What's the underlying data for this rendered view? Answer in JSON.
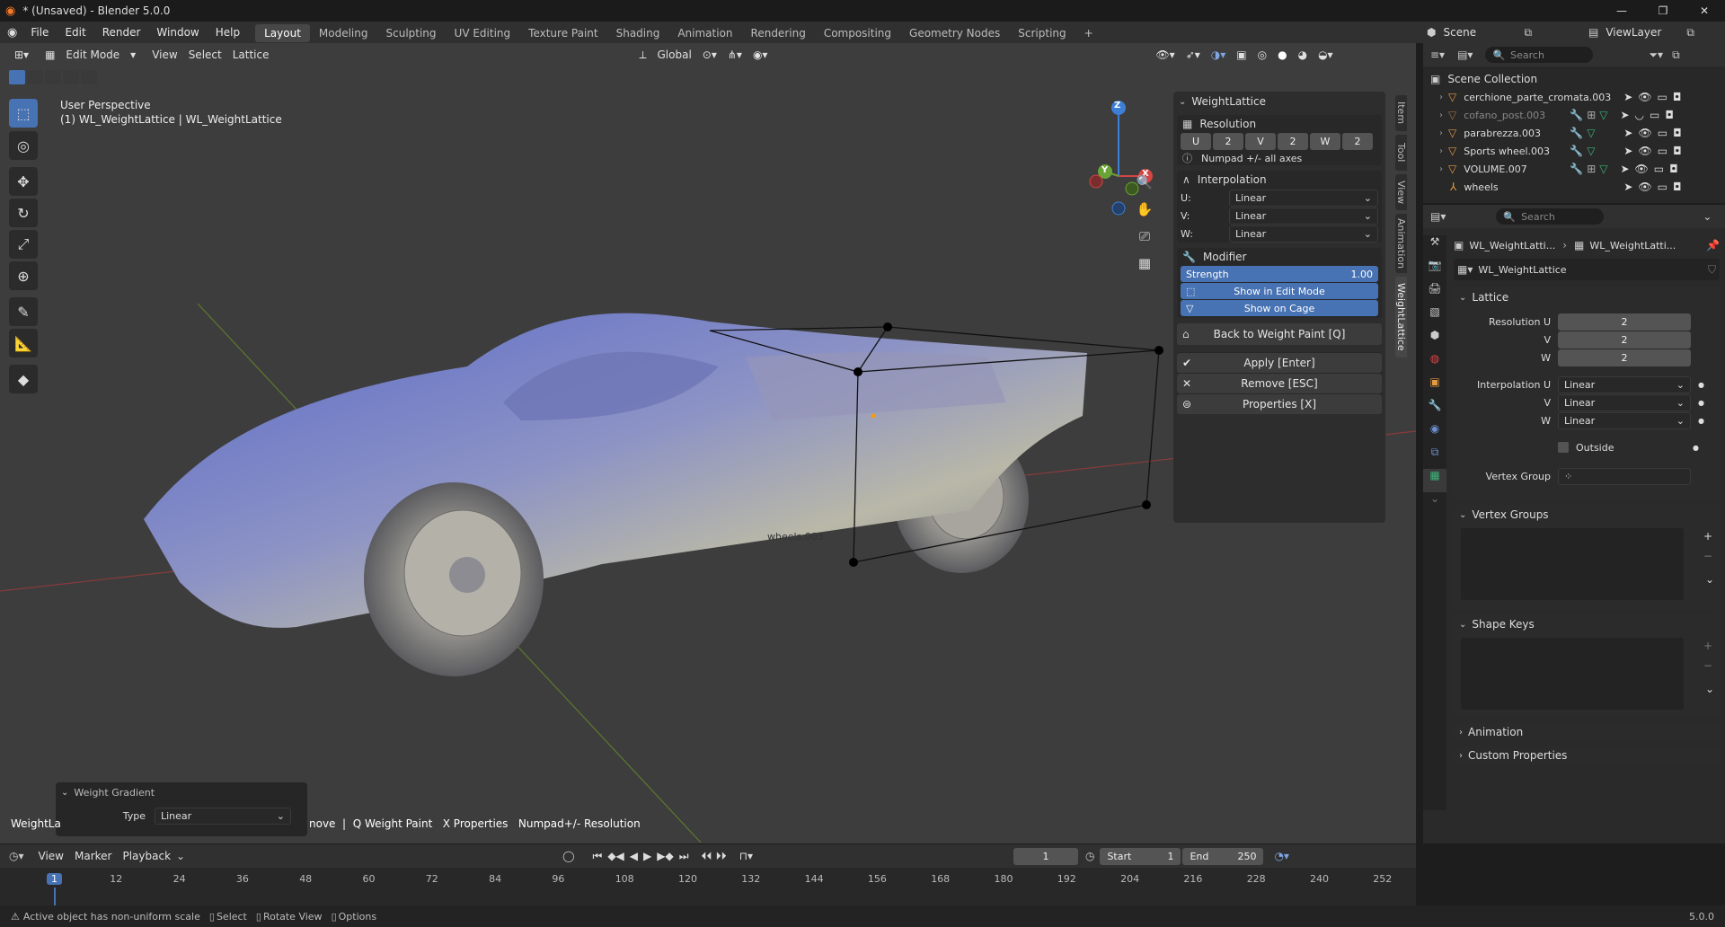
{
  "window": {
    "title": "* (Unsaved) - Blender 5.0.0"
  },
  "menu": {
    "items": [
      "File",
      "Edit",
      "Render",
      "Window",
      "Help"
    ]
  },
  "workspaces": [
    "Layout",
    "Modeling",
    "Sculpting",
    "UV Editing",
    "Texture Paint",
    "Shading",
    "Animation",
    "Rendering",
    "Compositing",
    "Geometry Nodes",
    "Scripting"
  ],
  "workspace_add": "+",
  "topright": {
    "scene": "Scene",
    "viewlayer": "ViewLayer"
  },
  "viewport": {
    "mode": "Edit Mode",
    "menus": [
      "View",
      "Select",
      "Lattice"
    ],
    "orientation": "Global",
    "overlay_title": "User Perspective",
    "overlay_sub": "(1) WL_WeightLattice | WL_WeightLattice",
    "object_label": "wheels.003",
    "hint_left": "WeightLa",
    "hint_text": "nove  |  Q Weight Paint   X Properties   Numpad+/- Resolution",
    "gizmo": {
      "x": "X",
      "y": "Y",
      "z": "Z"
    }
  },
  "npanel": {
    "header": "WeightLattice",
    "resolution": {
      "title": "Resolution",
      "u_label": "U",
      "u": "2",
      "v_label": "V",
      "v": "2",
      "w_label": "W",
      "w": "2",
      "hint": "Numpad +/- all axes"
    },
    "interpolation": {
      "title": "Interpolation",
      "u_label": "U:",
      "u": "Linear",
      "v_label": "V:",
      "v": "Linear",
      "w_label": "W:",
      "w": "Linear"
    },
    "modifier": {
      "title": "Modifier",
      "strength_label": "Strength",
      "strength": "1.00",
      "show_edit": "Show in Edit Mode",
      "show_cage": "Show on Cage"
    },
    "back": "Back to Weight Paint  [Q]",
    "apply": "Apply  [Enter]",
    "remove": "Remove  [ESC]",
    "properties": "Properties  [X]",
    "tabs": [
      "Item",
      "Tool",
      "View",
      "Animation",
      "WeightLattice"
    ]
  },
  "last_op": {
    "title": "Weight Gradient",
    "type_label": "Type",
    "type": "Linear"
  },
  "outliner": {
    "search_placeholder": "Search",
    "collection": "Scene Collection",
    "items": [
      {
        "name": "cerchione_parte_cromata.003"
      },
      {
        "name": "cofano_post.003"
      },
      {
        "name": "parabrezza.003"
      },
      {
        "name": "Sports wheel.003"
      },
      {
        "name": "VOLUME.007"
      },
      {
        "name": "wheels"
      }
    ]
  },
  "properties": {
    "search_placeholder": "Search",
    "breadcrumb_obj": "WL_WeightLatti...",
    "breadcrumb_data": "WL_WeightLatti...",
    "datablock": "WL_WeightLattice",
    "lattice": {
      "title": "Lattice",
      "res_u_label": "Resolution U",
      "res_u": "2",
      "res_v_label": "V",
      "res_v": "2",
      "res_w_label": "W",
      "res_w": "2",
      "interp_u_label": "Interpolation U",
      "interp_u": "Linear",
      "interp_v_label": "V",
      "interp_v": "Linear",
      "interp_w_label": "W",
      "interp_w": "Linear",
      "outside": "Outside",
      "vgroup_label": "Vertex Group"
    },
    "vertex_groups": "Vertex Groups",
    "shape_keys": "Shape Keys",
    "animation": "Animation",
    "custom_props": "Custom Properties"
  },
  "timeline": {
    "menus": [
      "View",
      "Marker",
      "Playback"
    ],
    "current_frame": "1",
    "start_label": "Start",
    "start": "1",
    "end_label": "End",
    "end": "250",
    "ticks": [
      "1",
      "12",
      "24",
      "36",
      "48",
      "60",
      "72",
      "84",
      "96",
      "108",
      "120",
      "132",
      "144",
      "156",
      "168",
      "180",
      "192",
      "204",
      "216",
      "228",
      "240",
      "252"
    ]
  },
  "statusbar": {
    "warning": "Active object has non-uniform scale",
    "select": "Select",
    "rotate": "Rotate View",
    "options": "Options",
    "version": "5.0.0"
  }
}
